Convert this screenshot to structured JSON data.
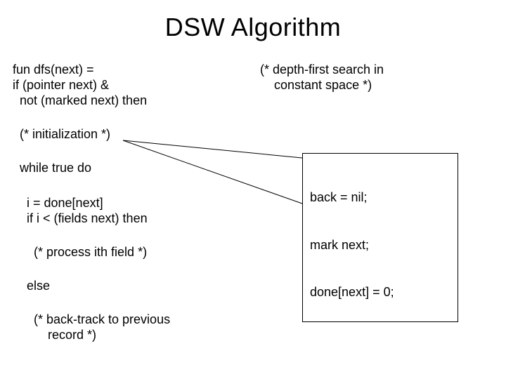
{
  "title": "DSW Algorithm",
  "left": {
    "l1": "fun dfs(next) =",
    "l2": "if (pointer next) &",
    "l3": "  not (marked next) then",
    "l4": "  (* initialization *)",
    "l5": "  while true do",
    "l6": "    i = done[next]",
    "l7": "    if i < (fields next) then",
    "l8": "      (* process ith field *)",
    "l9": "    else",
    "l10a": "      (* back-track to previous",
    "l10b": "          record *)"
  },
  "right": {
    "comment1": "(* depth-first search in",
    "comment2": "    constant space *)",
    "box1": "back = nil;",
    "box2": "mark next;",
    "box3": "done[next] = 0;"
  }
}
